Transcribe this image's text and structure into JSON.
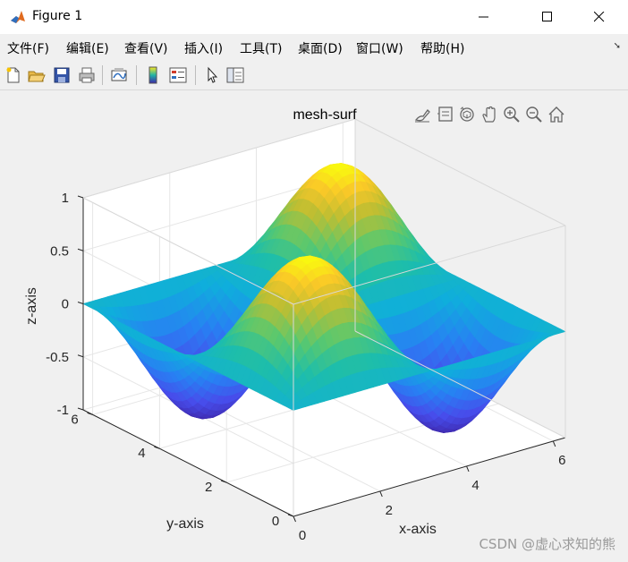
{
  "window": {
    "title": "Figure 1"
  },
  "menu": {
    "items": [
      {
        "label": "文件(F)"
      },
      {
        "label": "编辑(E)"
      },
      {
        "label": "查看(V)"
      },
      {
        "label": "插入(I)"
      },
      {
        "label": "工具(T)"
      },
      {
        "label": "桌面(D)"
      },
      {
        "label": "窗口(W)"
      },
      {
        "label": "帮助(H)"
      }
    ]
  },
  "toolbar": {
    "icons": [
      "new-figure-icon",
      "open-file-icon",
      "save-icon",
      "print-icon",
      "link-plot-icon",
      "insert-colorbar-icon",
      "insert-legend-icon",
      "pointer-icon",
      "property-inspector-icon"
    ]
  },
  "axes_toolbar": {
    "icons": [
      "brush-icon",
      "data-tip-icon",
      "rotate-3d-icon",
      "pan-icon",
      "zoom-in-icon",
      "zoom-out-icon",
      "home-icon"
    ]
  },
  "chart_data": {
    "type": "surface",
    "title": "mesh-surf",
    "xlabel": "x-axis",
    "ylabel": "y-axis",
    "zlabel": "z-axis",
    "x_ticks": [
      "0",
      "2",
      "4",
      "6"
    ],
    "y_ticks": [
      "0",
      "2",
      "4",
      "6"
    ],
    "z_ticks": [
      "-1",
      "-0.5",
      "0",
      "0.5",
      "1"
    ],
    "xlim": [
      0,
      6.2832
    ],
    "ylim": [
      0,
      6.2832
    ],
    "zlim": [
      -1,
      1
    ],
    "function": "z = sin(x) * sin(y)",
    "colormap": "parula",
    "grid": true,
    "box": true
  },
  "watermark": "CSDN @虚心求知的熊"
}
